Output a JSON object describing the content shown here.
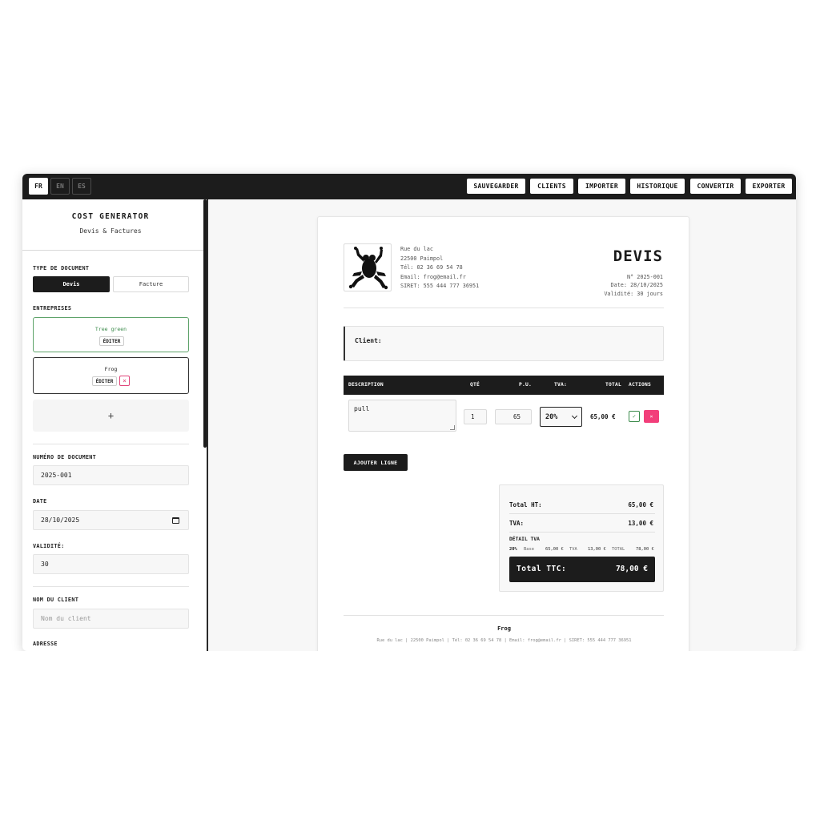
{
  "languages": [
    {
      "code": "FR",
      "active": true
    },
    {
      "code": "EN",
      "active": false
    },
    {
      "code": "ES",
      "active": false
    }
  ],
  "toolbar": {
    "save": "SAUVEGARDER",
    "clients": "CLIENTS",
    "import": "IMPORTER",
    "history": "HISTORIQUE",
    "convert": "CONVERTIR",
    "export": "EXPORTER"
  },
  "sidebar": {
    "title": "COST GENERATOR",
    "subtitle": "Devis & Factures",
    "doc_type_label": "TYPE DE DOCUMENT",
    "doc_type_options": [
      "Devis",
      "Facture"
    ],
    "doc_type_selected": "Devis",
    "companies_label": "ENTREPRISES",
    "companies": [
      {
        "name": "Tree green",
        "edit": "ÉDITER"
      },
      {
        "name": "Frog",
        "edit": "ÉDITER",
        "delete": "×"
      }
    ],
    "add_company": "+",
    "doc_number_label": "NUMÉRO DE DOCUMENT",
    "doc_number": "2025-001",
    "date_label": "DATE",
    "date": "28/10/2025",
    "validity_label": "VALIDITÉ:",
    "validity": "30",
    "client_name_label": "NOM DU CLIENT",
    "client_name_placeholder": "Nom du client",
    "address_label": "ADRESSE"
  },
  "document": {
    "company_address": {
      "street": "Rue du lac",
      "city": "22500 Paimpol",
      "phone": "Tél: 02 36 69 54 78",
      "email": "Email: frog@email.fr",
      "siret": "SIRET: 555 444 777 36951"
    },
    "title": "DEVIS",
    "number": "N° 2025-001",
    "date": "Date: 28/10/2025",
    "validity": "Validité: 30 jours",
    "client_label": "Client:",
    "table_headers": {
      "description": "DESCRIPTION",
      "qty": "QTÉ",
      "unit_price": "P.U.",
      "tva": "TVA:",
      "total": "TOTAL",
      "actions": "ACTIONS"
    },
    "lines": [
      {
        "description": "pull",
        "qty": "1",
        "unit_price": "65",
        "tva": "20%",
        "total": "65,00 €",
        "confirm": "✓",
        "delete": "×"
      }
    ],
    "add_line": "AJOUTER LIGNE",
    "totals": {
      "ht_label": "Total HT:",
      "ht_value": "65,00 €",
      "tva_label": "TVA:",
      "tva_value": "13,00 €",
      "detail_label": "DÉTAIL TVA",
      "detail_rate": "20%",
      "detail_base_label": "Base",
      "detail_base_value": "65,00 €",
      "detail_tva_label": "TVA",
      "detail_tva_value": "13,00 €",
      "detail_total_label": "TOTAL",
      "detail_total_value": "78,00 €",
      "ttc_label": "Total TTC:",
      "ttc_value": "78,00 €"
    },
    "footer": {
      "company": "Frog",
      "details": "Rue du lac | 22500 Paimpol | Tél: 02 36 69 54 78 | Email: frog@email.fr | SIRET: 555 444 777 36951"
    }
  },
  "colors": {
    "dark": "#1c1c1c",
    "accent_pink": "#f23e7a",
    "accent_green": "#3a8a4a"
  }
}
